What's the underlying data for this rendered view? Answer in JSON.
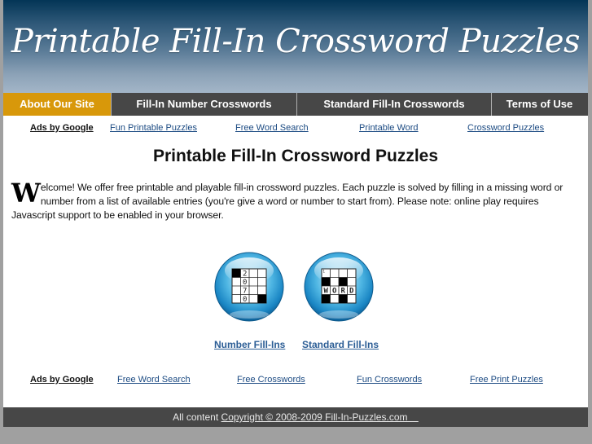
{
  "header": {
    "logo_text": "Printable Fill-In Crossword Puzzles"
  },
  "nav": {
    "items": [
      {
        "label": "About Our Site",
        "active": true
      },
      {
        "label": "Fill-In Number Crosswords",
        "active": false
      },
      {
        "label": "Standard Fill-In Crosswords",
        "active": false
      },
      {
        "label": "Terms of Use",
        "active": false
      }
    ]
  },
  "ads_top": {
    "label": "Ads by Google",
    "links": [
      "Fun Printable Puzzles",
      "Free Word Search",
      "Printable Word",
      "Crossword Puzzles"
    ]
  },
  "main": {
    "title": "Printable Fill-In Crossword Puzzles",
    "dropcap": "W",
    "intro": "elcome! We offer free printable and playable fill-in crossword puzzles. Each puzzle is solved by filling in a missing word or number from a list of available entries (you're give a word or number to start from). Please note: online play requires Javascript support to be enabled in your browser.",
    "puzzles": [
      {
        "label": "Number Fill-Ins",
        "icon": "number-grid-icon",
        "digits": [
          "2",
          "0",
          "7",
          "0"
        ]
      },
      {
        "label": "Standard Fill-Ins",
        "icon": "word-grid-icon",
        "letters": [
          "W",
          "O",
          "R",
          "D"
        ],
        "clue_number": "1"
      }
    ]
  },
  "ads_bottom": {
    "label": "Ads by Google",
    "links": [
      "Free Word Search",
      "Free Crosswords",
      "Fun Crosswords",
      "Free Print Puzzles"
    ]
  },
  "footer": {
    "prefix": "All content",
    "copyright": "Copyright © 2008-2009 Fill-In-Puzzles.com"
  },
  "colors": {
    "nav_active": "#d8980a",
    "nav_bg": "#474747",
    "link": "#2b5d95",
    "page_bg": "#a0a0a0",
    "header_top": "#033556",
    "header_bottom": "#a3b6c8"
  }
}
